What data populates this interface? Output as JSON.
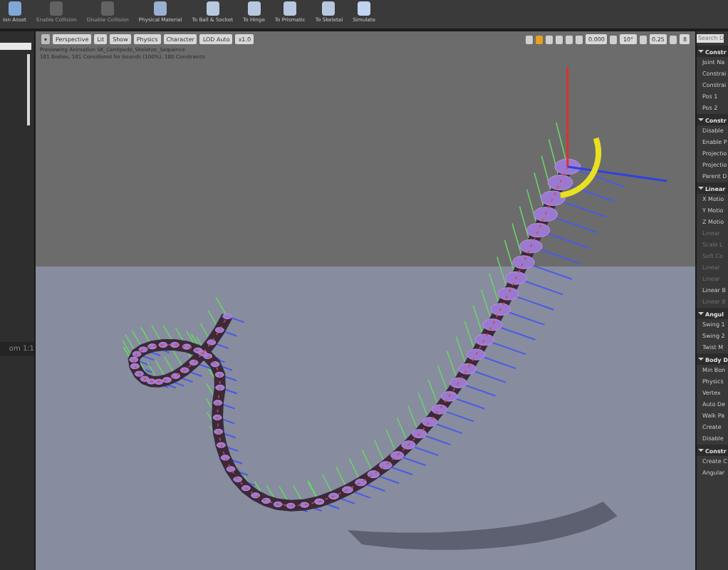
{
  "toolbar": {
    "buttons": [
      {
        "label": "ion Asset",
        "disabled": false,
        "kind": "asset"
      },
      {
        "label": "Enable Collision",
        "disabled": true,
        "kind": "collision"
      },
      {
        "label": "Disable Collision",
        "disabled": true,
        "kind": "collision"
      },
      {
        "label": "Physical Material",
        "disabled": false,
        "kind": "material"
      },
      {
        "label": "To Ball & Socket",
        "disabled": false,
        "kind": "joint"
      },
      {
        "label": "To Hinge",
        "disabled": false,
        "kind": "joint"
      },
      {
        "label": "To Prismatic",
        "disabled": false,
        "kind": "joint"
      },
      {
        "label": "To Skeletal",
        "disabled": false,
        "kind": "joint"
      },
      {
        "label": "Simulate",
        "disabled": false,
        "kind": "simulate"
      }
    ]
  },
  "left_panel": {
    "zoom_label": "om 1:1"
  },
  "viewport": {
    "buttons": [
      "Perspective",
      "Lit",
      "Show",
      "Physics",
      "Character",
      "LOD Auto",
      "x1.0"
    ],
    "snap_values": [
      "0.000",
      "10°",
      "0.25",
      "8"
    ],
    "info_lines": [
      "Previewing Animation SK_Centipede_Skeleton_Sequence",
      "181 Bodies, 181 Considered for bounds (100%), 180 Constraints"
    ]
  },
  "details_panel": {
    "search": {
      "placeholder": "Search D"
    },
    "sections": [
      {
        "title": "Constr",
        "expanded": true,
        "rows": [
          {
            "label": "Joint Na",
            "disabled": false
          },
          {
            "label": "Constrai",
            "disabled": false
          },
          {
            "label": "Constrai",
            "disabled": false
          },
          {
            "label": "Pos 1",
            "disabled": false
          },
          {
            "label": "Pos 2",
            "disabled": false
          }
        ]
      },
      {
        "title": "Constr",
        "expanded": true,
        "rows": [
          {
            "label": "Disable",
            "disabled": false
          },
          {
            "label": "Enable P",
            "disabled": false
          },
          {
            "label": "Projectio",
            "disabled": false
          },
          {
            "label": "Projectio",
            "disabled": false
          },
          {
            "label": "Parent D",
            "disabled": false
          }
        ]
      },
      {
        "title": "Linear",
        "expanded": true,
        "rows": [
          {
            "label": "X Motio",
            "disabled": false
          },
          {
            "label": "Y Motio",
            "disabled": false
          },
          {
            "label": "Z Motio",
            "disabled": false
          },
          {
            "label": "Linear",
            "disabled": true
          },
          {
            "label": "Scale L",
            "disabled": true
          },
          {
            "label": "Soft Co",
            "disabled": true
          },
          {
            "label": "Linear",
            "disabled": true
          },
          {
            "label": "Linear",
            "disabled": true
          },
          {
            "label": "Linear B",
            "disabled": false
          },
          {
            "label": "Linear B",
            "disabled": true
          }
        ]
      },
      {
        "title": "Angul",
        "expanded": true,
        "rows": [
          {
            "label": "Swing 1",
            "disabled": false
          },
          {
            "label": "Swing 2",
            "disabled": false
          },
          {
            "label": "Twist M",
            "disabled": false
          }
        ]
      },
      {
        "title": "Body D",
        "expanded": true,
        "rows": [
          {
            "label": "Min Bon",
            "disabled": false
          },
          {
            "label": "Physics",
            "disabled": false
          },
          {
            "label": "Vertex",
            "disabled": false
          },
          {
            "label": "Auto De",
            "disabled": false
          },
          {
            "label": "Walk Pa",
            "disabled": false
          },
          {
            "label": "Create",
            "disabled": false
          },
          {
            "label": "Disable",
            "disabled": false
          }
        ]
      },
      {
        "title": "Constr",
        "expanded": true,
        "rows": [
          {
            "label": "Create C",
            "disabled": false
          },
          {
            "label": "Angular",
            "disabled": false
          }
        ]
      }
    ]
  }
}
